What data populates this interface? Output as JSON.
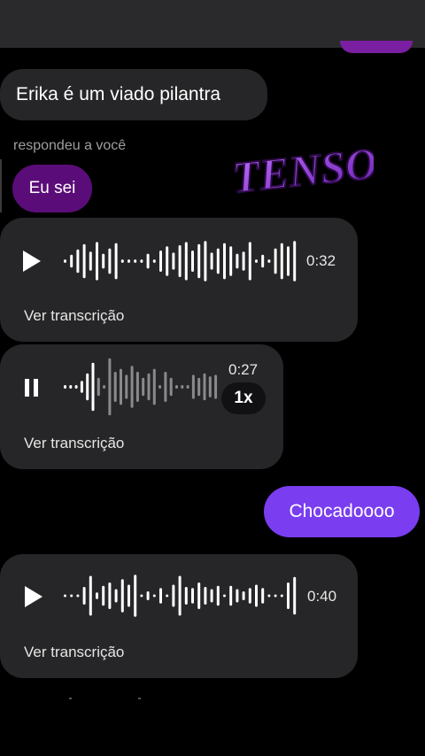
{
  "messages": {
    "text1": "Erika é um viado pilantra",
    "reply_label": "respondeu a você",
    "reply_text": "Eu sei",
    "sticker_text": "TENSO",
    "voice1": {
      "duration": "0:32",
      "transcribe": "Ver transcrição",
      "state": "paused"
    },
    "voice2": {
      "duration": "0:27",
      "transcribe": "Ver transcrição",
      "state": "playing",
      "speed": "1x",
      "progress": 0.2
    },
    "outgoing": "Chocadoooo",
    "voice3": {
      "duration": "0:40",
      "transcribe": "Ver transcrição",
      "state": "paused"
    }
  },
  "colors": {
    "background": "#000000",
    "incoming_bubble": "#262628",
    "outgoing_bubble": "#7a3df0",
    "reply_bubble": "#5a0d78",
    "sticker": "#9b4de0"
  },
  "icons": [
    "play-icon",
    "pause-icon",
    "waveform-icon"
  ]
}
